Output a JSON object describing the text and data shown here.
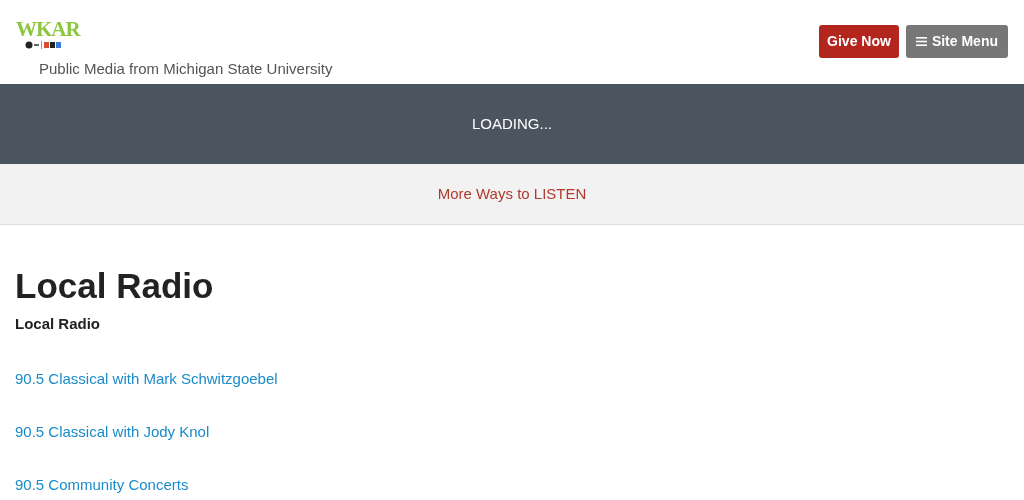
{
  "header": {
    "logo": "WKAR",
    "tagline": "Public Media from Michigan State University",
    "buttons": [
      {
        "kind": "give",
        "label": "Give Now"
      },
      {
        "kind": "menu",
        "label": "Site Menu"
      }
    ]
  },
  "player": {
    "status": "LOADING..."
  },
  "listen_bar": {
    "link": "More Ways to LISTEN"
  },
  "content": {
    "title": "Local Radio",
    "subtitle": "Local Radio",
    "links": [
      "90.5 Classical with Mark Schwitzgoebel",
      "90.5 Classical with Jody Knol",
      "90.5 Community Concerts"
    ]
  }
}
